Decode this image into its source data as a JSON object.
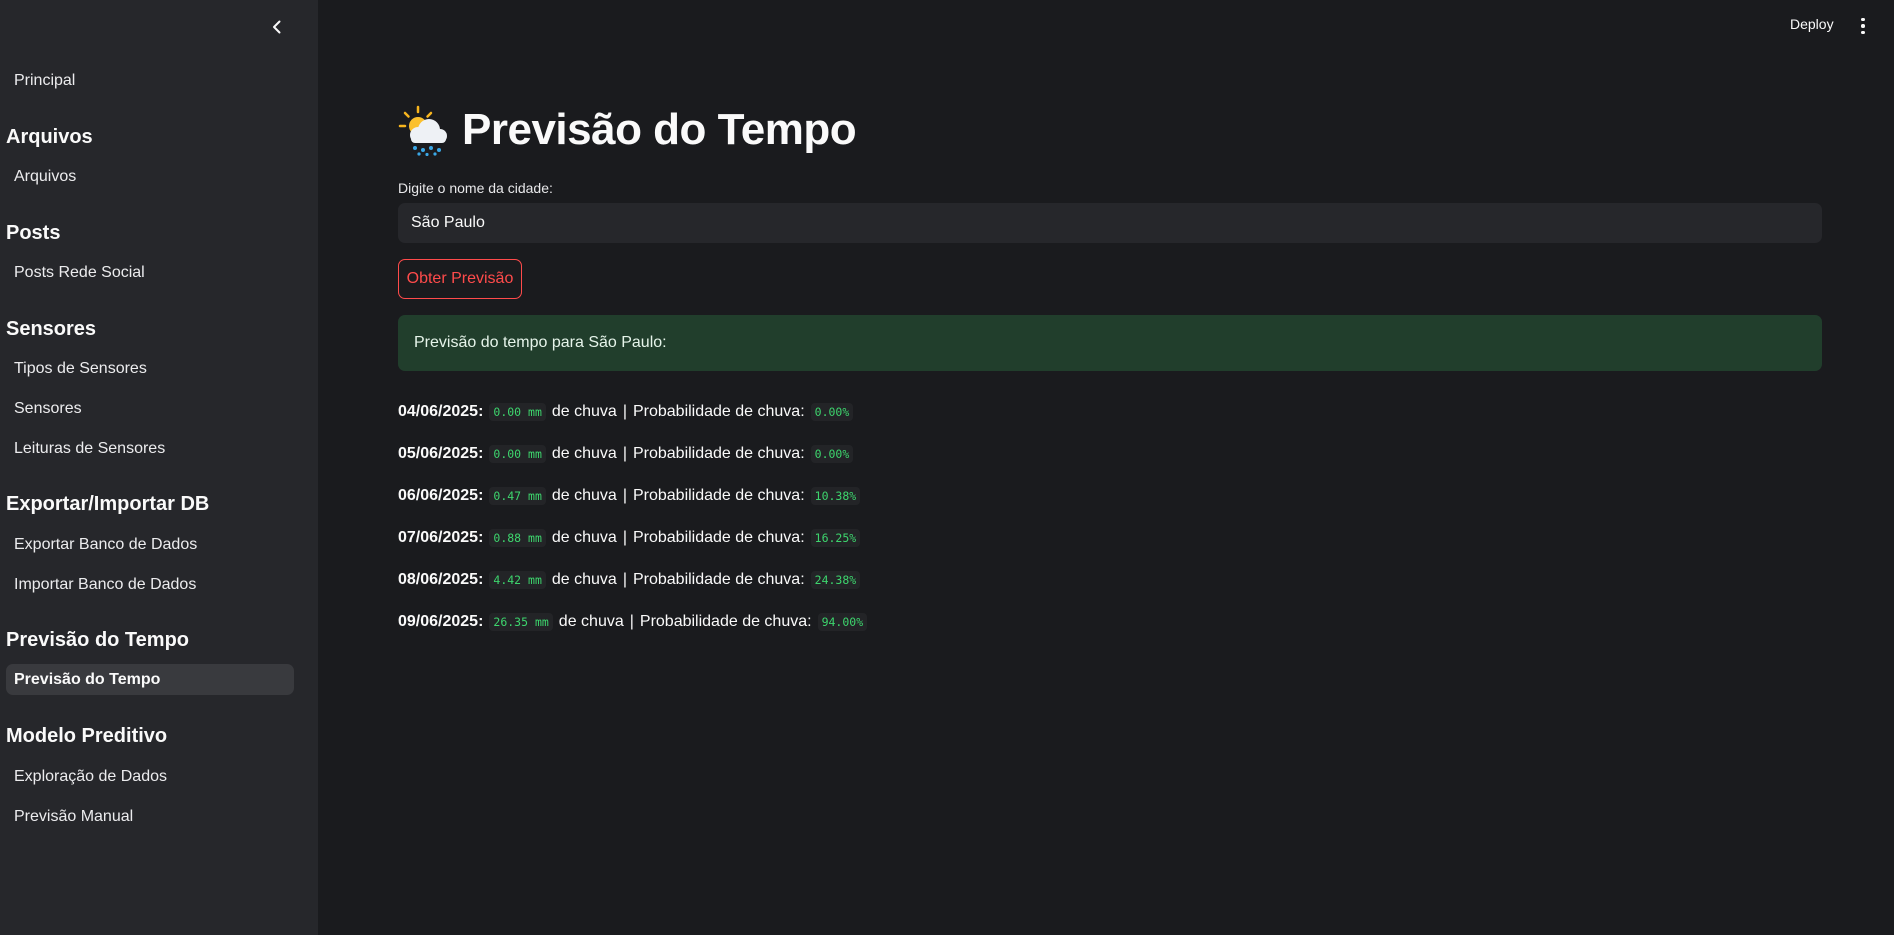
{
  "topbar": {
    "deploy_label": "Deploy"
  },
  "sidebar": {
    "items": [
      {
        "type": "link",
        "label": "Principal"
      },
      {
        "type": "header",
        "label": "Arquivos"
      },
      {
        "type": "link",
        "label": "Arquivos"
      },
      {
        "type": "header",
        "label": "Posts"
      },
      {
        "type": "link",
        "label": "Posts Rede Social"
      },
      {
        "type": "header",
        "label": "Sensores"
      },
      {
        "type": "link",
        "label": "Tipos de Sensores"
      },
      {
        "type": "link",
        "label": "Sensores"
      },
      {
        "type": "link",
        "label": "Leituras de Sensores"
      },
      {
        "type": "header",
        "label": "Exportar/Importar DB"
      },
      {
        "type": "link",
        "label": "Exportar Banco de Dados"
      },
      {
        "type": "link",
        "label": "Importar Banco de Dados"
      },
      {
        "type": "header",
        "label": "Previsão do Tempo"
      },
      {
        "type": "link",
        "label": "Previsão do Tempo",
        "active": true
      },
      {
        "type": "header",
        "label": "Modelo Preditivo"
      },
      {
        "type": "link",
        "label": "Exploração de Dados"
      },
      {
        "type": "link",
        "label": "Previsão Manual"
      }
    ]
  },
  "main": {
    "title": "Previsão do Tempo",
    "city_label": "Digite o nome da cidade:",
    "city_value": "São Paulo",
    "submit_label": "Obter Previsão",
    "success_message": "Previsão do tempo para São Paulo:",
    "rain_text": "de chuva",
    "separator": "|",
    "prob_label": "Probabilidade de chuva:",
    "forecast": [
      {
        "date": "04/06/2025:",
        "rain": "0.00 mm",
        "prob": "0.00%"
      },
      {
        "date": "05/06/2025:",
        "rain": "0.00 mm",
        "prob": "0.00%"
      },
      {
        "date": "06/06/2025:",
        "rain": "0.47 mm",
        "prob": "10.38%"
      },
      {
        "date": "07/06/2025:",
        "rain": "0.88 mm",
        "prob": "16.25%"
      },
      {
        "date": "08/06/2025:",
        "rain": "4.42 mm",
        "prob": "24.38%"
      },
      {
        "date": "09/06/2025:",
        "rain": "26.35 mm",
        "prob": "94.00%"
      }
    ]
  },
  "colors": {
    "accent": "#ff4b4b",
    "success_bg": "#213e2c",
    "code_text": "#3dd56d"
  },
  "icons": {
    "collapse": "chevron-left-icon",
    "menu": "kebab-menu-icon",
    "title": "sun-behind-rain-cloud-icon"
  }
}
